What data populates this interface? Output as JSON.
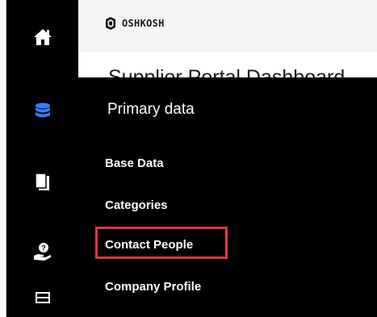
{
  "header": {
    "brand": "OSHKOSH",
    "page_title": "Supplier Portal Dashboard"
  },
  "sidebar": {
    "items": [
      {
        "icon": "home-icon"
      },
      {
        "icon": "database-icon",
        "active": true
      },
      {
        "icon": "documents-icon"
      },
      {
        "icon": "help-hand-icon"
      },
      {
        "icon": "tray-icon"
      }
    ],
    "accent_color": "#3b7cff"
  },
  "menu": {
    "title": "Primary data",
    "items": [
      {
        "label": "Base Data"
      },
      {
        "label": "Categories"
      },
      {
        "label": "Contact People",
        "highlighted": true
      },
      {
        "label": "Company Profile"
      }
    ],
    "highlight_color": "#e0393e"
  }
}
